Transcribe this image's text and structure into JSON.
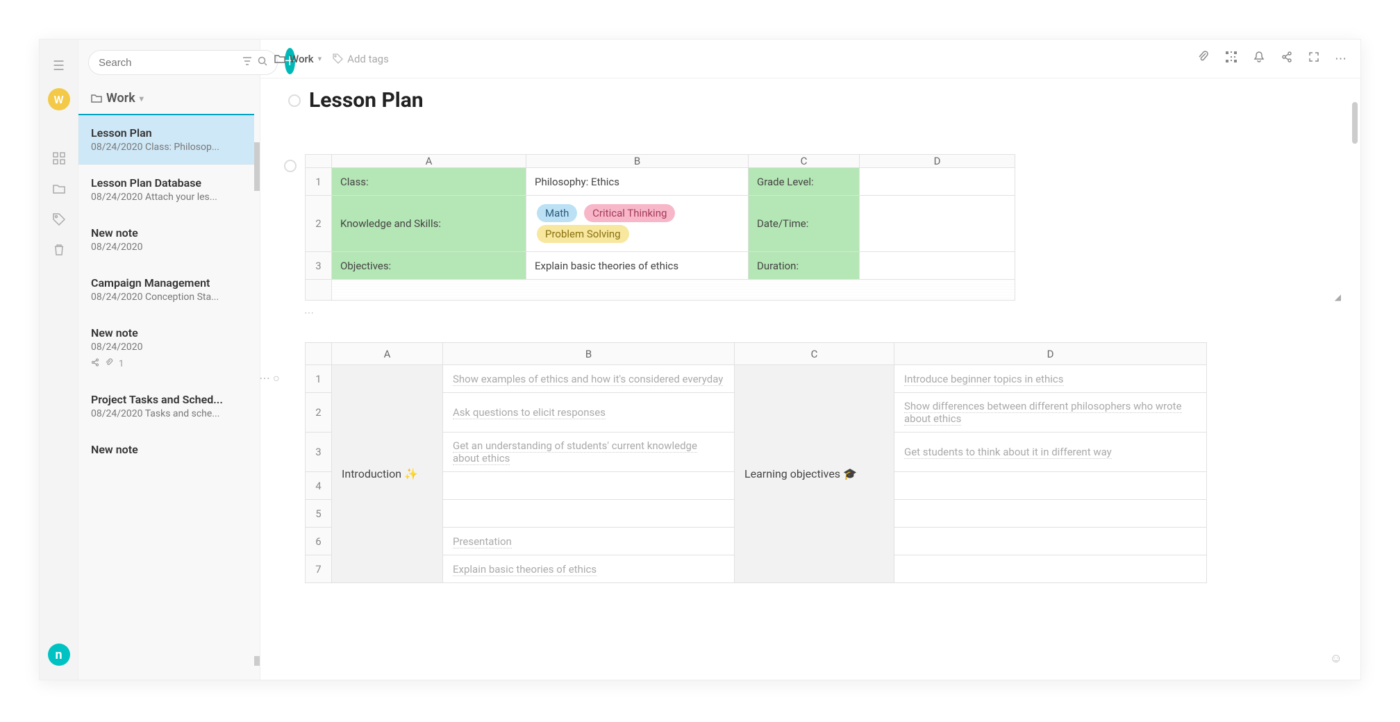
{
  "search": {
    "placeholder": "Search"
  },
  "avatar_letter": "W",
  "folder": {
    "label": "Work"
  },
  "notes": [
    {
      "title": "Lesson Plan",
      "subtitle": "08/24/2020 Class: Philosop...",
      "active": true
    },
    {
      "title": "Lesson Plan Database",
      "subtitle": "08/24/2020 Attach your les..."
    },
    {
      "title": "New note",
      "subtitle": "08/24/2020"
    },
    {
      "title": "Campaign Management",
      "subtitle": "08/24/2020 Conception Sta..."
    },
    {
      "title": "New note",
      "subtitle": "08/24/2020",
      "meta": "1"
    },
    {
      "title": "Project Tasks and Sched...",
      "subtitle": "08/24/2020 Tasks and sche..."
    },
    {
      "title": "New note",
      "subtitle": ""
    }
  ],
  "breadcrumb": {
    "icon": "folder",
    "label": "Work"
  },
  "add_tags_hint": "Add tags",
  "page_title": "Lesson Plan",
  "table1": {
    "cols": [
      "A",
      "B",
      "C",
      "D"
    ],
    "rows": [
      {
        "num": "1",
        "a": "Class:",
        "b_text": "Philosophy: Ethics",
        "c": "Grade Level:"
      },
      {
        "num": "2",
        "a": "Knowledge and Skills:",
        "pills": [
          "Math",
          "Critical Thinking",
          "Problem Solving"
        ],
        "c": "Date/Time:"
      },
      {
        "num": "3",
        "a": "Objectives:",
        "b_text": "Explain basic theories of ethics",
        "c": "Duration:"
      }
    ]
  },
  "table2": {
    "cols": [
      "A",
      "B",
      "C",
      "D"
    ],
    "a_label": "Introduction ✨",
    "c_label": "Learning objectives 🎓",
    "rows": [
      {
        "num": "1",
        "b": "Show examples of ethics and how it's considered everyday",
        "d": "Introduce beginner topics in ethics"
      },
      {
        "num": "2",
        "b": "Ask questions to elicit responses",
        "d": "Show differences between different philosophers who wrote about ethics"
      },
      {
        "num": "3",
        "b": "Get an understanding of students' current knowledge about ethics",
        "d": "Get students to think about it in different way"
      },
      {
        "num": "4",
        "b": "",
        "d": ""
      },
      {
        "num": "5",
        "b": "",
        "d": ""
      },
      {
        "num": "6",
        "b": "Presentation",
        "d": ""
      },
      {
        "num": "7",
        "b": "Explain basic theories of ethics",
        "d": ""
      }
    ]
  }
}
